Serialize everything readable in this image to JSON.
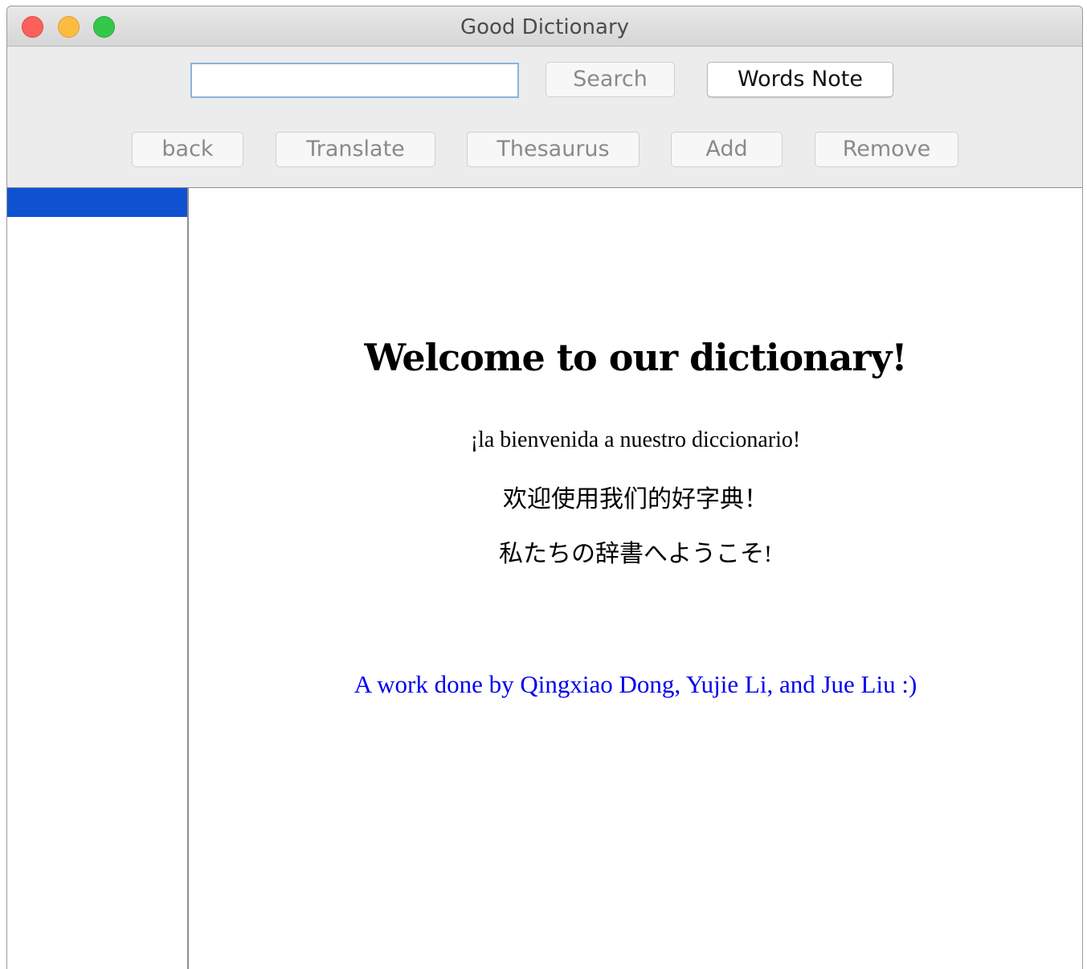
{
  "window": {
    "title": "Good Dictionary"
  },
  "toolbar": {
    "search_value": "",
    "search_label": "Search",
    "words_note_label": "Words Note",
    "back_label": "back",
    "translate_label": "Translate",
    "thesaurus_label": "Thesaurus",
    "add_label": "Add",
    "remove_label": "Remove"
  },
  "content": {
    "welcome": "Welcome to our dictionary!",
    "spanish": "¡la bienvenida a nuestro diccionario!",
    "chinese": "欢迎使用我们的好字典！",
    "japanese": "私たちの辞書へようこそ!",
    "credit": "A work done by Qingxiao Dong, Yujie Li, and Jue Liu :)"
  },
  "colors": {
    "selection": "#0e52d2",
    "credit_link": "#0000ee",
    "close": "#fc605b",
    "minimize": "#fdbc40",
    "zoom": "#34c84a"
  }
}
